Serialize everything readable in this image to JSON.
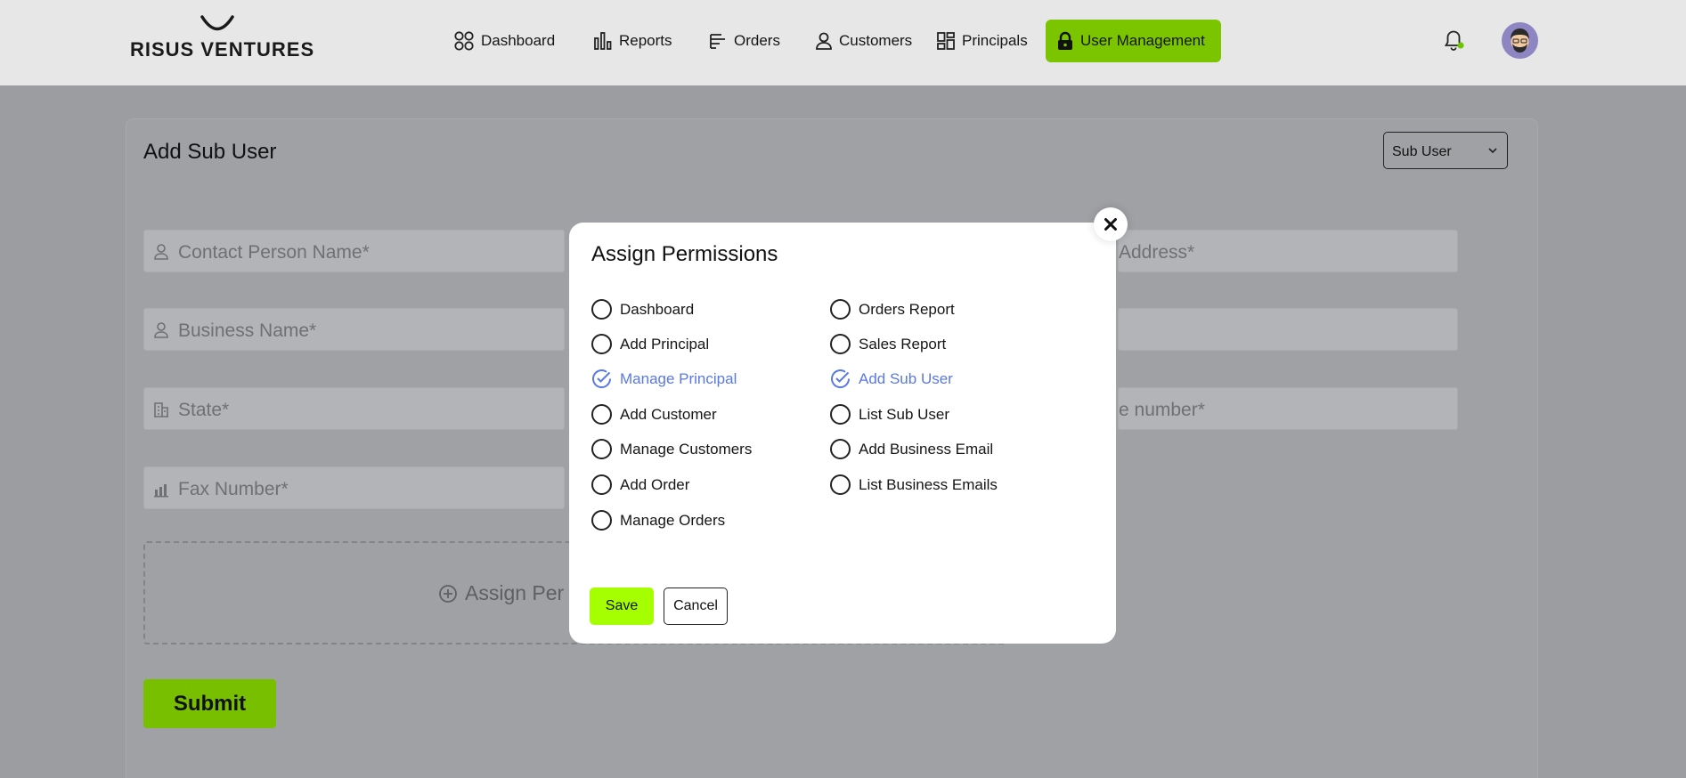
{
  "app": {
    "logo_text": "RISUS VENTURES"
  },
  "nav": [
    {
      "label": "Dashboard",
      "icon": "dashboard-icon"
    },
    {
      "label": "Reports",
      "icon": "reports-icon"
    },
    {
      "label": "Orders",
      "icon": "orders-icon"
    },
    {
      "label": "Customers",
      "icon": "customers-icon"
    },
    {
      "label": "Principals",
      "icon": "principals-icon"
    },
    {
      "label": "User Management",
      "icon": "lock-icon",
      "active": true
    }
  ],
  "colors": {
    "accent": "#7bc500",
    "save": "#a6ff00",
    "checked": "#5a78e6"
  },
  "page": {
    "title": "Add Sub User",
    "user_type": "Sub User",
    "fields": {
      "contact_person": "Contact Person Name*",
      "business_name": "Business Name*",
      "state": "State*",
      "fax": "Fax Number*",
      "address": "Address*",
      "phone": "e number*"
    },
    "assign_label": "Assign Per",
    "submit": "Submit"
  },
  "modal": {
    "title": "Assign Permissions",
    "left": [
      {
        "label": "Dashboard",
        "checked": false
      },
      {
        "label": "Add Principal",
        "checked": false
      },
      {
        "label": "Manage Principal",
        "checked": true
      },
      {
        "label": "Add Customer",
        "checked": false
      },
      {
        "label": "Manage Customers",
        "checked": false
      },
      {
        "label": "Add Order",
        "checked": false
      },
      {
        "label": "Manage Orders",
        "checked": false
      }
    ],
    "right": [
      {
        "label": "Orders Report",
        "checked": false
      },
      {
        "label": "Sales Report",
        "checked": false
      },
      {
        "label": "Add Sub User",
        "checked": true
      },
      {
        "label": "List Sub User",
        "checked": false
      },
      {
        "label": "Add Business Email",
        "checked": false
      },
      {
        "label": "List Business Emails",
        "checked": false
      }
    ],
    "save": "Save",
    "cancel": "Cancel"
  }
}
